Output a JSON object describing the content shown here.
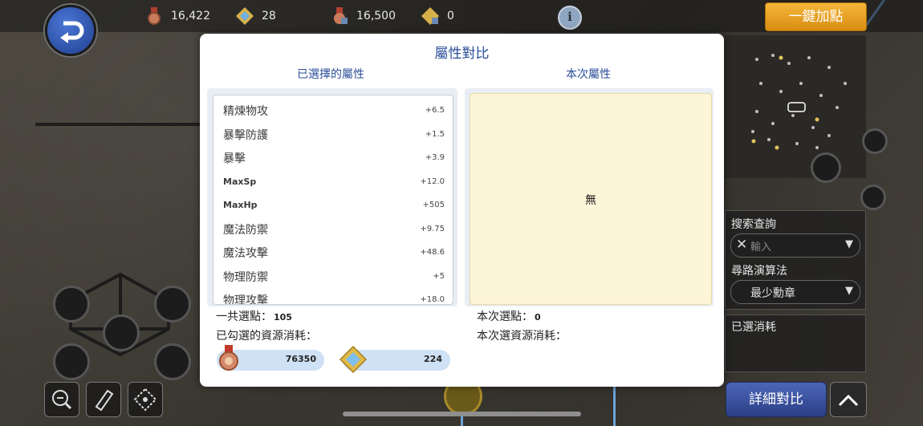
{
  "topbar": {
    "resources": [
      {
        "icon": "medal-icon",
        "value": "16,422"
      },
      {
        "icon": "cross-gem-icon",
        "value": "28"
      },
      {
        "icon": "locked-medal-icon",
        "value": "16,500"
      },
      {
        "icon": "locked-cross-gem-icon",
        "value": "0"
      }
    ],
    "info_label": "i",
    "one_click_label": "一鍵加點"
  },
  "modal": {
    "title": "屬性對比",
    "left_header": "已選擇的屬性",
    "right_header": "本次屬性",
    "attributes": [
      {
        "name": "精煉物攻",
        "value": "+6.5"
      },
      {
        "name": "暴擊防護",
        "value": "+1.5"
      },
      {
        "name": "暴擊",
        "value": "+3.9"
      },
      {
        "name": "MaxSp",
        "value": "+12.0"
      },
      {
        "name": "MaxHp",
        "value": "+505"
      },
      {
        "name": "魔法防禦",
        "value": "+9.75"
      },
      {
        "name": "魔法攻擊",
        "value": "+48.6"
      },
      {
        "name": "物理防禦",
        "value": "+5"
      },
      {
        "name": "物理攻擊",
        "value": "+18.0"
      }
    ],
    "right_empty": "無",
    "total_points_label": "一共選點：",
    "total_points_value": "105",
    "checked_cost_label": "已勾選的資源消耗：",
    "current_points_label": "本次選點：",
    "current_points_value": "0",
    "current_cost_label": "本次選資源消耗：",
    "costs": [
      {
        "icon": "medal-icon",
        "value": "76350"
      },
      {
        "icon": "cross-gem-icon",
        "value": "224"
      }
    ]
  },
  "side": {
    "search_label": "搜索查詢",
    "search_placeholder": "輸入",
    "algo_label": "尋路演算法",
    "algo_value": "最少勳章",
    "selected_cost_label": "已選消耗",
    "compare_label": "詳細對比"
  },
  "colors": {
    "accent": "#2a4e9a",
    "gold_button": "#e9a328",
    "compare_button": "#3a52a0"
  }
}
